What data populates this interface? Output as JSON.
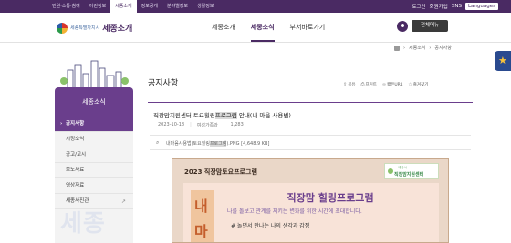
{
  "topbar": {
    "nav": [
      "민원·소통·참여",
      "어린정보",
      "세종소개",
      "정보공개",
      "분야별정보",
      "생활정보"
    ],
    "active_index": 2,
    "login": "로그인",
    "join": "회원가입",
    "sns": "SNS",
    "languages": "Languages"
  },
  "header": {
    "city": "세종특별자치시",
    "title": "세종소개",
    "nav": [
      "세종소개",
      "세종소식",
      "부서바로가기"
    ],
    "active_nav": "세종소식",
    "all_menu": "전체메뉴"
  },
  "breadcrumb": [
    "세종소식",
    "공지사항"
  ],
  "sidebar": {
    "heading": "세종소식",
    "items": [
      "공지사항",
      "시정소식",
      "공고/고시",
      "보도자료",
      "영상자료",
      "세종사진관"
    ],
    "watermark": "세종"
  },
  "content": {
    "page_title": "공지사항",
    "tools": [
      {
        "icon": "share-icon",
        "label": "공유"
      },
      {
        "icon": "print-icon",
        "label": "프린트"
      },
      {
        "icon": "link-icon",
        "label": "짧은URL"
      },
      {
        "icon": "star-icon",
        "label": "즐겨찾기"
      }
    ],
    "post": {
      "title_before": "직장맘지원센터 토요힐링",
      "title_highlight": "프로그램",
      "title_after": " 안내(내 마음 사용법)",
      "date": "2023-10-18",
      "department": "여성가족과",
      "views": "1,283"
    },
    "attachment": {
      "name_before": "내마음사용법(토요힐링",
      "name_highlight": "프로그램",
      "name_after": ").PNG [4,648.9 KB]"
    },
    "poster": {
      "top": "2023 직장맘토요프로그램",
      "logo_small": "세종시",
      "logo_big": "직장맘지원센터",
      "big_chars": [
        "내",
        "마"
      ],
      "headline": "직장맘 힐링프로그램",
      "subhead": "나를 돌보고 관계를 지키는 변화를 위한 시간에 초대합니다.",
      "bullet": "# 놀면서 만나는 나의 생각과 감정"
    }
  },
  "colors": {
    "brand": "#4a2a63",
    "sidebar_accent": "#6a3e8c",
    "float_tab": "#2a4a8f"
  }
}
